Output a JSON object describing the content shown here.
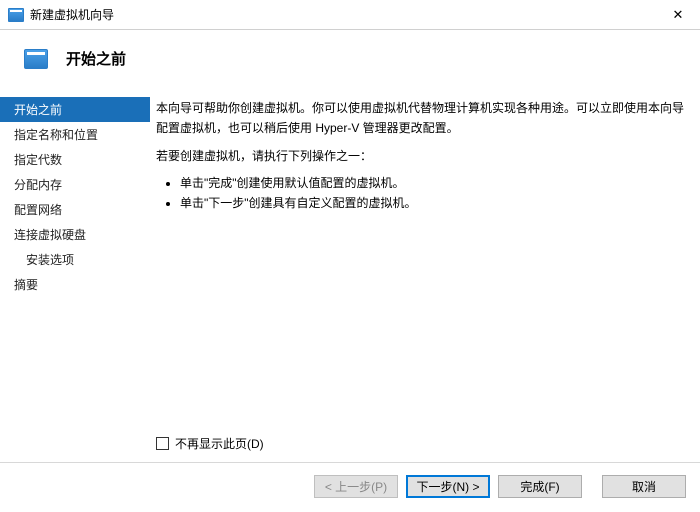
{
  "window": {
    "title": "新建虚拟机向导",
    "close_glyph": "✕"
  },
  "header": {
    "title": "开始之前"
  },
  "sidebar": {
    "items": [
      {
        "label": "开始之前"
      },
      {
        "label": "指定名称和位置"
      },
      {
        "label": "指定代数"
      },
      {
        "label": "分配内存"
      },
      {
        "label": "配置网络"
      },
      {
        "label": "连接虚拟硬盘"
      },
      {
        "label": "安装选项"
      },
      {
        "label": "摘要"
      }
    ]
  },
  "main": {
    "para1": "本向导可帮助你创建虚拟机。你可以使用虚拟机代替物理计算机实现各种用途。可以立即使用本向导配置虚拟机，也可以稍后使用 Hyper-V 管理器更改配置。",
    "para2": "若要创建虚拟机，请执行下列操作之一：",
    "bullet1": "单击\"完成\"创建使用默认值配置的虚拟机。",
    "bullet2": "单击\"下一步\"创建具有自定义配置的虚拟机。",
    "checkbox_label": "不再显示此页(D)"
  },
  "footer": {
    "prev": "< 上一步(P)",
    "next": "下一步(N) >",
    "finish": "完成(F)",
    "cancel": "取消"
  }
}
